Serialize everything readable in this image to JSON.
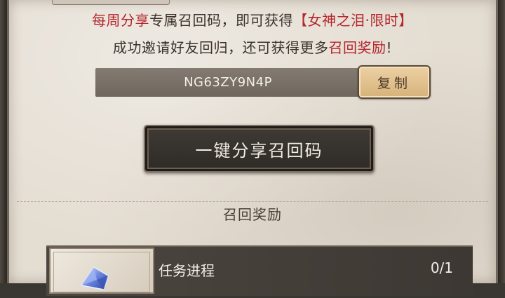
{
  "promo": {
    "line1_red1": "每周分享",
    "line1_mid": "专属召回码，即可获得",
    "line1_red2": "【女神之泪·限时】",
    "line2_start": "成功邀请好友回归，还可获得更多",
    "line2_red": "召回奖励",
    "line2_end": "!"
  },
  "recall": {
    "code": "NG63ZY9N4P",
    "copy_label": "复制"
  },
  "share_button": {
    "label": "一键分享召回码"
  },
  "rewards_section": {
    "title": "召回奖励",
    "task_label": "任务进程",
    "task_progress": "0/1"
  },
  "colors": {
    "accent_red": "#b5262b",
    "panel_bg": "#e4ddd2",
    "copy_gold": "#d7b27a"
  }
}
